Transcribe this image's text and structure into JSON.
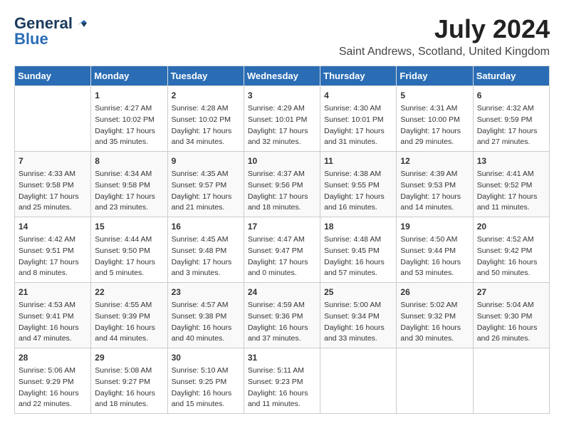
{
  "header": {
    "logo_line1": "General",
    "logo_line2": "Blue",
    "month_year": "July 2024",
    "location": "Saint Andrews, Scotland, United Kingdom"
  },
  "days_of_week": [
    "Sunday",
    "Monday",
    "Tuesday",
    "Wednesday",
    "Thursday",
    "Friday",
    "Saturday"
  ],
  "weeks": [
    [
      {
        "day": "",
        "content": ""
      },
      {
        "day": "1",
        "content": "Sunrise: 4:27 AM\nSunset: 10:02 PM\nDaylight: 17 hours\nand 35 minutes."
      },
      {
        "day": "2",
        "content": "Sunrise: 4:28 AM\nSunset: 10:02 PM\nDaylight: 17 hours\nand 34 minutes."
      },
      {
        "day": "3",
        "content": "Sunrise: 4:29 AM\nSunset: 10:01 PM\nDaylight: 17 hours\nand 32 minutes."
      },
      {
        "day": "4",
        "content": "Sunrise: 4:30 AM\nSunset: 10:01 PM\nDaylight: 17 hours\nand 31 minutes."
      },
      {
        "day": "5",
        "content": "Sunrise: 4:31 AM\nSunset: 10:00 PM\nDaylight: 17 hours\nand 29 minutes."
      },
      {
        "day": "6",
        "content": "Sunrise: 4:32 AM\nSunset: 9:59 PM\nDaylight: 17 hours\nand 27 minutes."
      }
    ],
    [
      {
        "day": "7",
        "content": "Sunrise: 4:33 AM\nSunset: 9:58 PM\nDaylight: 17 hours\nand 25 minutes."
      },
      {
        "day": "8",
        "content": "Sunrise: 4:34 AM\nSunset: 9:58 PM\nDaylight: 17 hours\nand 23 minutes."
      },
      {
        "day": "9",
        "content": "Sunrise: 4:35 AM\nSunset: 9:57 PM\nDaylight: 17 hours\nand 21 minutes."
      },
      {
        "day": "10",
        "content": "Sunrise: 4:37 AM\nSunset: 9:56 PM\nDaylight: 17 hours\nand 18 minutes."
      },
      {
        "day": "11",
        "content": "Sunrise: 4:38 AM\nSunset: 9:55 PM\nDaylight: 17 hours\nand 16 minutes."
      },
      {
        "day": "12",
        "content": "Sunrise: 4:39 AM\nSunset: 9:53 PM\nDaylight: 17 hours\nand 14 minutes."
      },
      {
        "day": "13",
        "content": "Sunrise: 4:41 AM\nSunset: 9:52 PM\nDaylight: 17 hours\nand 11 minutes."
      }
    ],
    [
      {
        "day": "14",
        "content": "Sunrise: 4:42 AM\nSunset: 9:51 PM\nDaylight: 17 hours\nand 8 minutes."
      },
      {
        "day": "15",
        "content": "Sunrise: 4:44 AM\nSunset: 9:50 PM\nDaylight: 17 hours\nand 5 minutes."
      },
      {
        "day": "16",
        "content": "Sunrise: 4:45 AM\nSunset: 9:48 PM\nDaylight: 17 hours\nand 3 minutes."
      },
      {
        "day": "17",
        "content": "Sunrise: 4:47 AM\nSunset: 9:47 PM\nDaylight: 17 hours\nand 0 minutes."
      },
      {
        "day": "18",
        "content": "Sunrise: 4:48 AM\nSunset: 9:45 PM\nDaylight: 16 hours\nand 57 minutes."
      },
      {
        "day": "19",
        "content": "Sunrise: 4:50 AM\nSunset: 9:44 PM\nDaylight: 16 hours\nand 53 minutes."
      },
      {
        "day": "20",
        "content": "Sunrise: 4:52 AM\nSunset: 9:42 PM\nDaylight: 16 hours\nand 50 minutes."
      }
    ],
    [
      {
        "day": "21",
        "content": "Sunrise: 4:53 AM\nSunset: 9:41 PM\nDaylight: 16 hours\nand 47 minutes."
      },
      {
        "day": "22",
        "content": "Sunrise: 4:55 AM\nSunset: 9:39 PM\nDaylight: 16 hours\nand 44 minutes."
      },
      {
        "day": "23",
        "content": "Sunrise: 4:57 AM\nSunset: 9:38 PM\nDaylight: 16 hours\nand 40 minutes."
      },
      {
        "day": "24",
        "content": "Sunrise: 4:59 AM\nSunset: 9:36 PM\nDaylight: 16 hours\nand 37 minutes."
      },
      {
        "day": "25",
        "content": "Sunrise: 5:00 AM\nSunset: 9:34 PM\nDaylight: 16 hours\nand 33 minutes."
      },
      {
        "day": "26",
        "content": "Sunrise: 5:02 AM\nSunset: 9:32 PM\nDaylight: 16 hours\nand 30 minutes."
      },
      {
        "day": "27",
        "content": "Sunrise: 5:04 AM\nSunset: 9:30 PM\nDaylight: 16 hours\nand 26 minutes."
      }
    ],
    [
      {
        "day": "28",
        "content": "Sunrise: 5:06 AM\nSunset: 9:29 PM\nDaylight: 16 hours\nand 22 minutes."
      },
      {
        "day": "29",
        "content": "Sunrise: 5:08 AM\nSunset: 9:27 PM\nDaylight: 16 hours\nand 18 minutes."
      },
      {
        "day": "30",
        "content": "Sunrise: 5:10 AM\nSunset: 9:25 PM\nDaylight: 16 hours\nand 15 minutes."
      },
      {
        "day": "31",
        "content": "Sunrise: 5:11 AM\nSunset: 9:23 PM\nDaylight: 16 hours\nand 11 minutes."
      },
      {
        "day": "",
        "content": ""
      },
      {
        "day": "",
        "content": ""
      },
      {
        "day": "",
        "content": ""
      }
    ]
  ]
}
